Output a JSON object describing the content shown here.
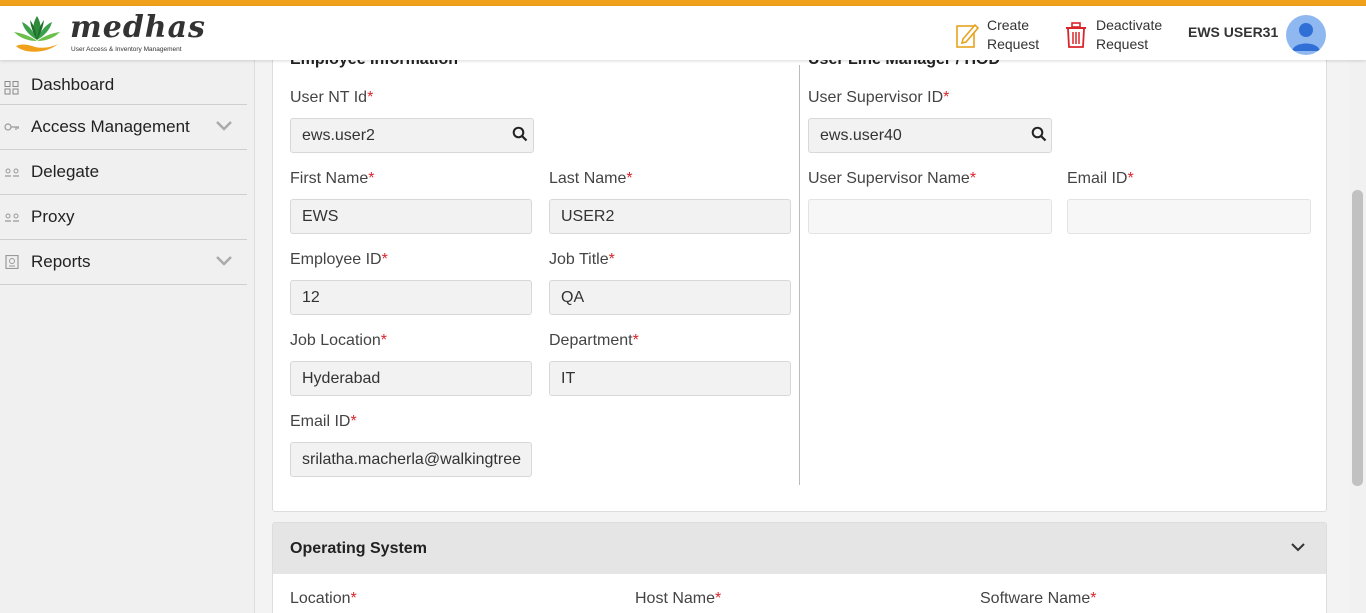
{
  "brand": {
    "name": "medhas",
    "tagline": "User Access & Inventory Management"
  },
  "header": {
    "create_line1": "Create",
    "create_line2": "Request",
    "deactivate_line1": "Deactivate",
    "deactivate_line2": "Request",
    "username": "EWS USER31"
  },
  "sidebar": {
    "items": [
      {
        "label": "Dashboard",
        "icon": "grid-icon"
      },
      {
        "label": "Access Management",
        "icon": "key-icon",
        "expandable": true
      },
      {
        "label": "Delegate",
        "icon": "delegate-icon"
      },
      {
        "label": "Proxy",
        "icon": "proxy-icon"
      },
      {
        "label": "Reports",
        "icon": "report-icon",
        "expandable": true
      }
    ]
  },
  "employee": {
    "title": "Employee Information",
    "nt_id_label": "User NT Id",
    "nt_id_value": "ews.user2",
    "first_name_label": "First Name",
    "first_name_value": "EWS",
    "last_name_label": "Last Name",
    "last_name_value": "USER2",
    "employee_id_label": "Employee ID",
    "employee_id_value": "12",
    "job_title_label": "Job Title",
    "job_title_value": "QA",
    "job_location_label": "Job Location",
    "job_location_value": "Hyderabad",
    "department_label": "Department",
    "department_value": "IT",
    "email_label": "Email ID",
    "email_value": "srilatha.macherla@walkingtree"
  },
  "manager": {
    "title": "User Line Manager / HOD",
    "supervisor_id_label": "User Supervisor ID",
    "supervisor_id_value": "ews.user40",
    "supervisor_name_label": "User Supervisor Name",
    "supervisor_name_value": "",
    "email_label": "Email ID",
    "email_value": ""
  },
  "os": {
    "title": "Operating System",
    "location_label": "Location",
    "host_label": "Host Name",
    "software_label": "Software Name"
  },
  "required_mark": "*",
  "colors": {
    "accent": "#f0a11c",
    "required": "#d9252b"
  }
}
